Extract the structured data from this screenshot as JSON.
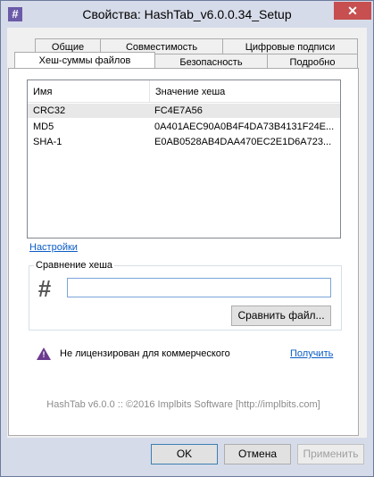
{
  "window": {
    "title": "Свойства: HashTab_v6.0.0.34_Setup",
    "close_glyph": "✕",
    "icon_glyph": "#"
  },
  "tabs": {
    "row1": [
      "Общие",
      "Совместимость",
      "Цифровые подписи"
    ],
    "row2": [
      "Хеш-суммы файлов",
      "Безопасность",
      "Подробно"
    ],
    "active": "Хеш-суммы файлов"
  },
  "hash_list": {
    "columns": [
      "Имя",
      "Значение хеша"
    ],
    "rows": [
      {
        "name": "CRC32",
        "value": "FC4E7A56"
      },
      {
        "name": "MD5",
        "value": "0A401AEC90A0B4F4DA73B4131F24E..."
      },
      {
        "name": "SHA-1",
        "value": "E0AB0528AB4DAA470EC2E1D6A723..."
      }
    ],
    "selected_row": 0
  },
  "settings_link": "Настройки",
  "compare": {
    "label": "Сравнение хеша",
    "input_value": "",
    "compare_button": "Сравнить файл...",
    "icon": "hash-icon"
  },
  "license": {
    "text": "Не лицензирован для коммерческого",
    "get_link": "Получить",
    "warning_mark": "!"
  },
  "footer": "HashTab v6.0.0 :: ©2016 Implbits Software [http://implbits.com]",
  "buttons": {
    "ok": "OK",
    "cancel": "Отмена",
    "apply": "Применить"
  },
  "colors": {
    "frame": "#d6dbe9",
    "close": "#c74f50",
    "link": "#0b5cc4",
    "warning": "#6b3a8e"
  }
}
